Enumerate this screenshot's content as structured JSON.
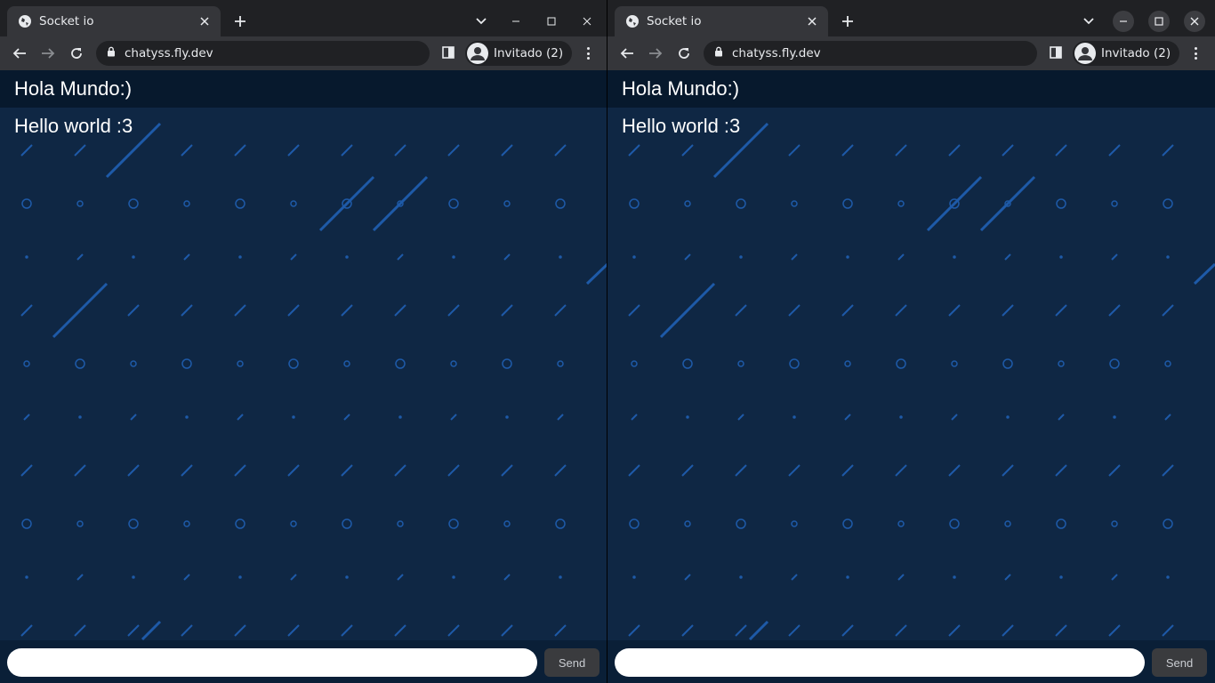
{
  "windows": [
    {
      "tab": {
        "title": "Socket io",
        "favicon": "globe-icon"
      },
      "address": {
        "url": "chatyss.fly.dev",
        "lock": "lock-icon"
      },
      "profile": {
        "label": "Invitado (2)"
      },
      "chat": {
        "messages": [
          "Hola Mundo:)",
          "Hello world :3"
        ],
        "input": {
          "value": "",
          "placeholder": ""
        },
        "send_label": "Send"
      }
    },
    {
      "tab": {
        "title": "Socket io",
        "favicon": "globe-icon"
      },
      "address": {
        "url": "chatyss.fly.dev",
        "lock": "lock-icon"
      },
      "profile": {
        "label": "Invitado (2)"
      },
      "chat": {
        "messages": [
          "Hola Mundo:)",
          "Hello world :3"
        ],
        "input": {
          "value": "",
          "placeholder": ""
        },
        "send_label": "Send"
      }
    }
  ],
  "colors": {
    "browser_frame": "#202124",
    "toolbar": "#35363a",
    "page_background": "#0f2744",
    "pattern": "#1e5aa8",
    "message_text": "#ffffff"
  }
}
